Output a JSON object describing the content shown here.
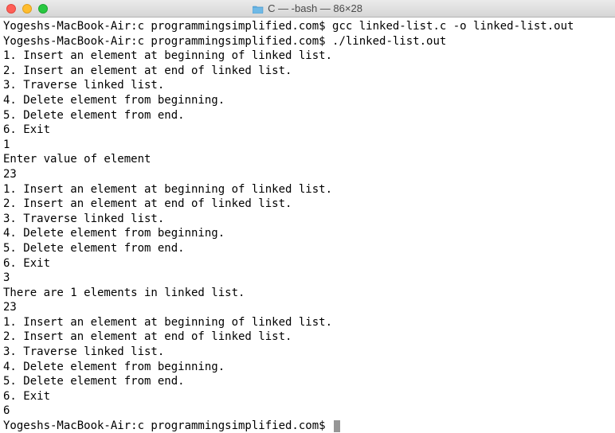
{
  "window": {
    "title": "C — -bash — 86×28"
  },
  "terminal": {
    "prompt": "Yogeshs-MacBook-Air:c programmingsimplified.com$",
    "cmd_compile": "gcc linked-list.c -o linked-list.out",
    "cmd_run": "./linked-list.out",
    "menu1": "1. Insert an element at beginning of linked list.",
    "menu2": "2. Insert an element at end of linked list.",
    "menu3": "3. Traverse linked list.",
    "menu4": "4. Delete element from beginning.",
    "menu5": "5. Delete element from end.",
    "menu6": "6. Exit",
    "input1": "1",
    "ask_value": "Enter value of element",
    "value23": "23",
    "input3": "3",
    "traverse_msg": "There are 1 elements in linked list.",
    "input6": "6"
  }
}
